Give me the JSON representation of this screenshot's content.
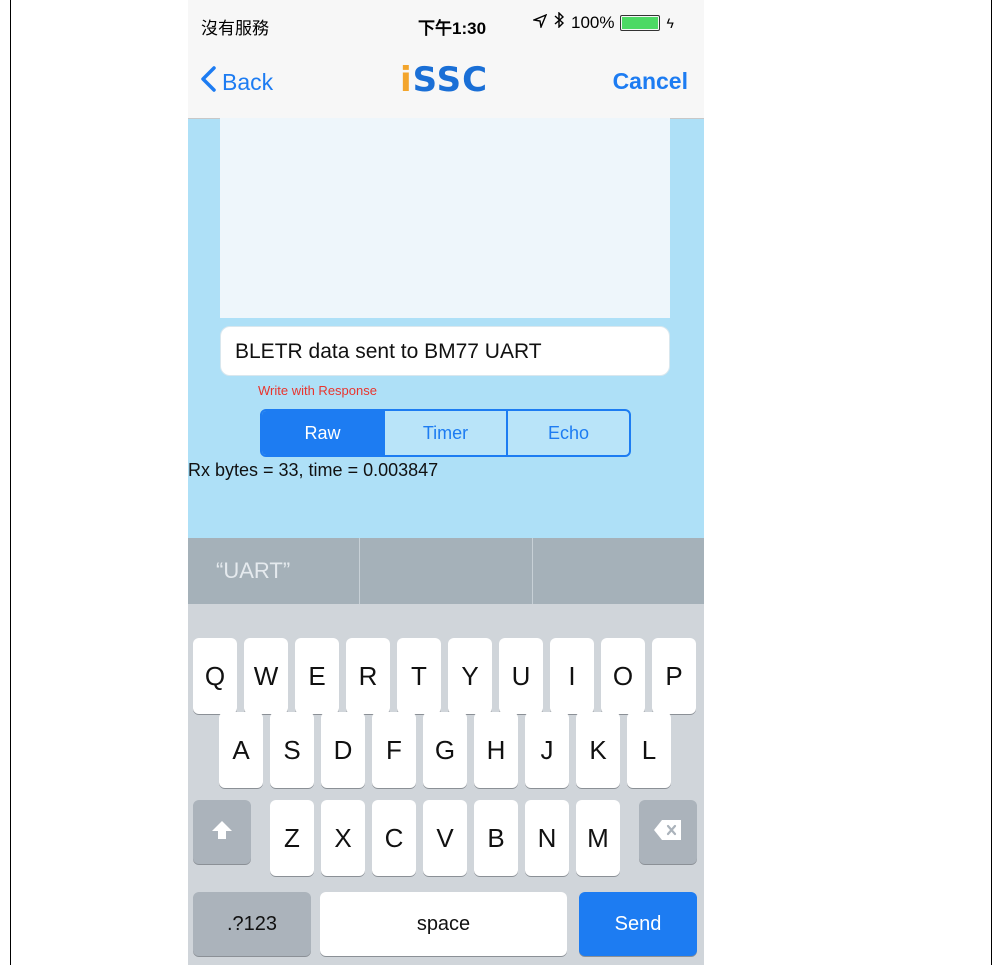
{
  "status_bar": {
    "carrier": "沒有服務",
    "time": "下午1:30",
    "battery": "100%"
  },
  "nav": {
    "back_label": "Back",
    "logo_text": "iSSC",
    "logo_i": "i",
    "logo_rest": "SSC",
    "cancel_label": "Cancel"
  },
  "input": {
    "value": "BLETR data sent to BM77 UART"
  },
  "mode_label": "Write with Response",
  "segments": [
    {
      "label": "Raw",
      "selected": true
    },
    {
      "label": "Timer",
      "selected": false
    },
    {
      "label": "Echo",
      "selected": false
    }
  ],
  "rx_status": "Rx bytes = 33, time = 0.003847",
  "suggestions": [
    "“UART”",
    "",
    ""
  ],
  "keyboard": {
    "row1": [
      "Q",
      "W",
      "E",
      "R",
      "T",
      "Y",
      "U",
      "I",
      "O",
      "P"
    ],
    "row2": [
      "A",
      "S",
      "D",
      "F",
      "G",
      "H",
      "J",
      "K",
      "L"
    ],
    "row3": [
      "Z",
      "X",
      "C",
      "V",
      "B",
      "N",
      "M"
    ],
    "numbers_label": ".?123",
    "space_label": "space",
    "send_label": "Send"
  },
  "colors": {
    "accent": "#1d7cf2",
    "background": "#aee0f7",
    "warning_text": "#e8352e"
  },
  "icons": {
    "back": "chevron-left-icon",
    "location": "location-arrow-icon",
    "bluetooth": "bluetooth-icon",
    "battery": "battery-icon",
    "shift": "shift-icon",
    "delete": "backspace-icon"
  }
}
